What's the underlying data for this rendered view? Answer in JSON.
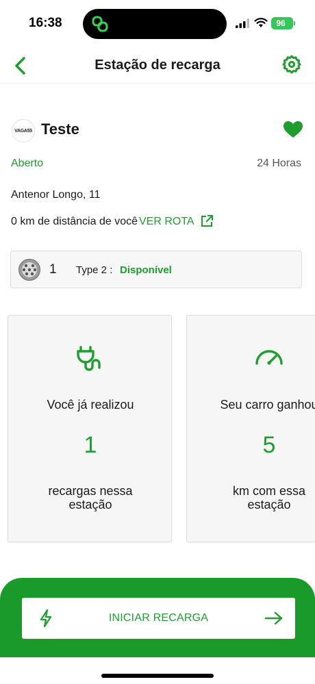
{
  "status_bar": {
    "time": "16:38",
    "battery": "96"
  },
  "header": {
    "title": "Estação de recarga",
    "back_icon": "chevron-left-icon",
    "settings_icon": "gear-icon"
  },
  "station": {
    "logo_text": "VAGA55",
    "name": "Teste",
    "favorite_icon": "heart-icon",
    "open_status": "Aberto",
    "hours": "24 Horas",
    "address": "Antenor Longo, 11",
    "distance": "0 km de distância de você",
    "route_label": "VER ROTA"
  },
  "connector": {
    "count": "1",
    "type": "Type 2 :",
    "status": "Disponível"
  },
  "stats": [
    {
      "icon": "plug-icon",
      "label": "Você já realizou",
      "value": "1",
      "caption_line1": "recargas nessa",
      "caption_line2": "estação"
    },
    {
      "icon": "speedometer-icon",
      "label": "Seu carro ganhou",
      "value": "5",
      "caption_line1": "km com essa",
      "caption_line2": "estação"
    }
  ],
  "action": {
    "label": "INICIAR RECARGA",
    "left_icon": "bolt-icon",
    "right_icon": "arrow-right-icon"
  },
  "colors": {
    "accent": "#1e9e2e",
    "panel": "#1a9a2b"
  }
}
